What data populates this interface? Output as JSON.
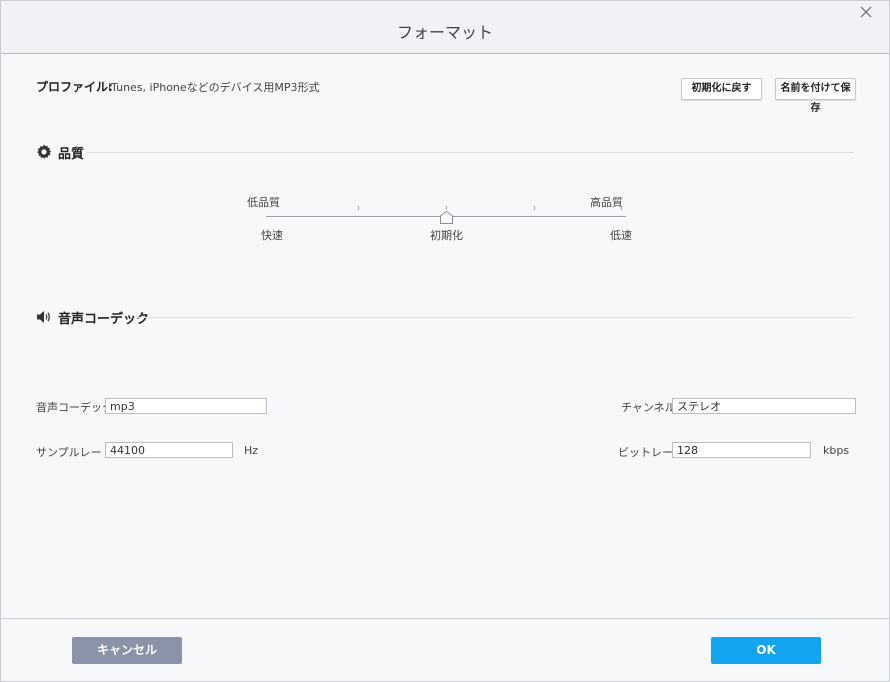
{
  "dialog": {
    "title": "フォーマット",
    "close_icon": "close-icon"
  },
  "profile": {
    "label": "プロファイル:",
    "value": "iTunes, iPhoneなどのデバイス用MP3形式",
    "reset_button": "初期化に戻す",
    "save_as_button": "名前を付けて保存"
  },
  "quality": {
    "header": "品質",
    "icon": "gear-icon",
    "low_label": "低品質",
    "high_label": "高品質",
    "fast_label": "快速",
    "default_label": "初期化",
    "slow_label": "低速"
  },
  "codec_section": {
    "header": "音声コーデック",
    "icon": "speaker-icon",
    "codec_label": "音声コーデック:",
    "codec_value": "mp3",
    "channel_label": "チャンネル:",
    "channel_value": "ステレオ",
    "sample_rate_label": "サンプルレート:",
    "sample_rate_value": "44100",
    "sample_rate_unit": "Hz",
    "bitrate_label": "ビットレート:",
    "bitrate_value": "128",
    "bitrate_unit": "kbps"
  },
  "footer": {
    "cancel_button": "キャンセル",
    "ok_button": "OK"
  },
  "colors": {
    "ok_button": "#12a4ee",
    "cancel_button": "#8a93a8"
  }
}
